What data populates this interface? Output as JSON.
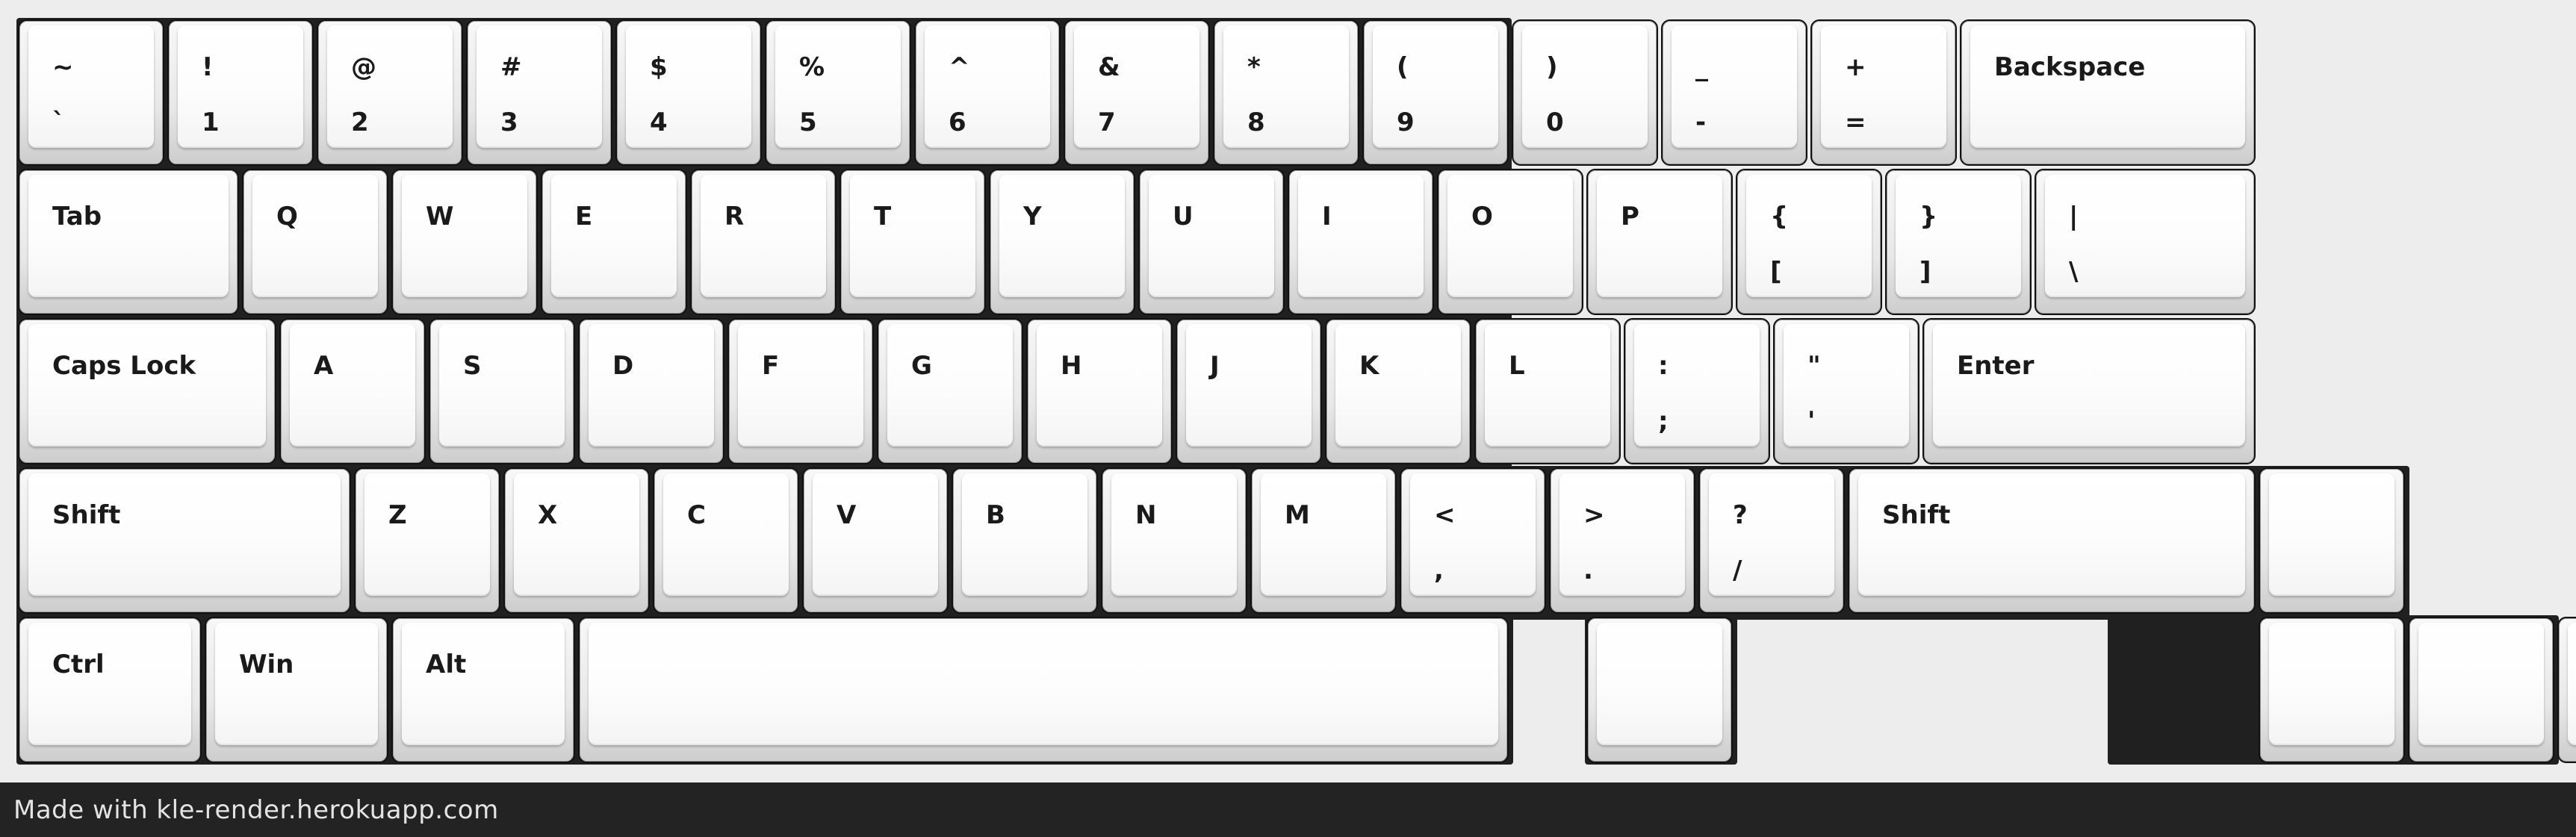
{
  "keyboard": {
    "rows": [
      [
        {
          "top": "~",
          "bottom": "`"
        },
        {
          "top": "!",
          "bottom": "1"
        },
        {
          "top": "@",
          "bottom": "2"
        },
        {
          "top": "#",
          "bottom": "3"
        },
        {
          "top": "$",
          "bottom": "4"
        },
        {
          "top": "%",
          "bottom": "5"
        },
        {
          "top": "^",
          "bottom": "6"
        },
        {
          "top": "&",
          "bottom": "7"
        },
        {
          "top": "*",
          "bottom": "8"
        },
        {
          "top": "(",
          "bottom": "9"
        },
        {
          "top": ")",
          "bottom": "0"
        },
        {
          "top": "_",
          "bottom": "-"
        },
        {
          "top": "+",
          "bottom": "="
        },
        {
          "label": "Backspace"
        }
      ],
      [
        {
          "label": "Tab"
        },
        {
          "label": "Q"
        },
        {
          "label": "W"
        },
        {
          "label": "E"
        },
        {
          "label": "R"
        },
        {
          "label": "T"
        },
        {
          "label": "Y"
        },
        {
          "label": "U"
        },
        {
          "label": "I"
        },
        {
          "label": "O"
        },
        {
          "label": "P"
        },
        {
          "top": "{",
          "bottom": "["
        },
        {
          "top": "}",
          "bottom": "]"
        },
        {
          "top": "|",
          "bottom": "\\"
        }
      ],
      [
        {
          "label": "Caps Lock"
        },
        {
          "label": "A"
        },
        {
          "label": "S"
        },
        {
          "label": "D"
        },
        {
          "label": "F"
        },
        {
          "label": "G"
        },
        {
          "label": "H"
        },
        {
          "label": "J"
        },
        {
          "label": "K"
        },
        {
          "label": "L"
        },
        {
          "top": ":",
          "bottom": ";"
        },
        {
          "top": "\"",
          "bottom": "'"
        },
        {
          "label": "Enter"
        }
      ],
      [
        {
          "label": "Shift"
        },
        {
          "label": "Z"
        },
        {
          "label": "X"
        },
        {
          "label": "C"
        },
        {
          "label": "V"
        },
        {
          "label": "B"
        },
        {
          "label": "N"
        },
        {
          "label": "M"
        },
        {
          "top": "<",
          "bottom": ","
        },
        {
          "top": ">",
          "bottom": "."
        },
        {
          "top": "?",
          "bottom": "/"
        },
        {
          "label": "Shift"
        },
        {
          "label": ""
        }
      ],
      [
        {
          "label": "Ctrl"
        },
        {
          "label": "Win"
        },
        {
          "label": "Alt"
        },
        {
          "label": ""
        },
        {
          "label": ""
        },
        {
          "label": ""
        },
        {
          "label": ""
        },
        {
          "label": ""
        }
      ]
    ]
  },
  "footer": {
    "credit": "Made with kle-render.herokuapp.com"
  },
  "colors": {
    "background": "#ededed",
    "plate": "#202020",
    "keycap": "#ffffff",
    "legend": "#1a1a1a",
    "footer_bg": "#232323",
    "footer_text": "#e4e4e4"
  }
}
